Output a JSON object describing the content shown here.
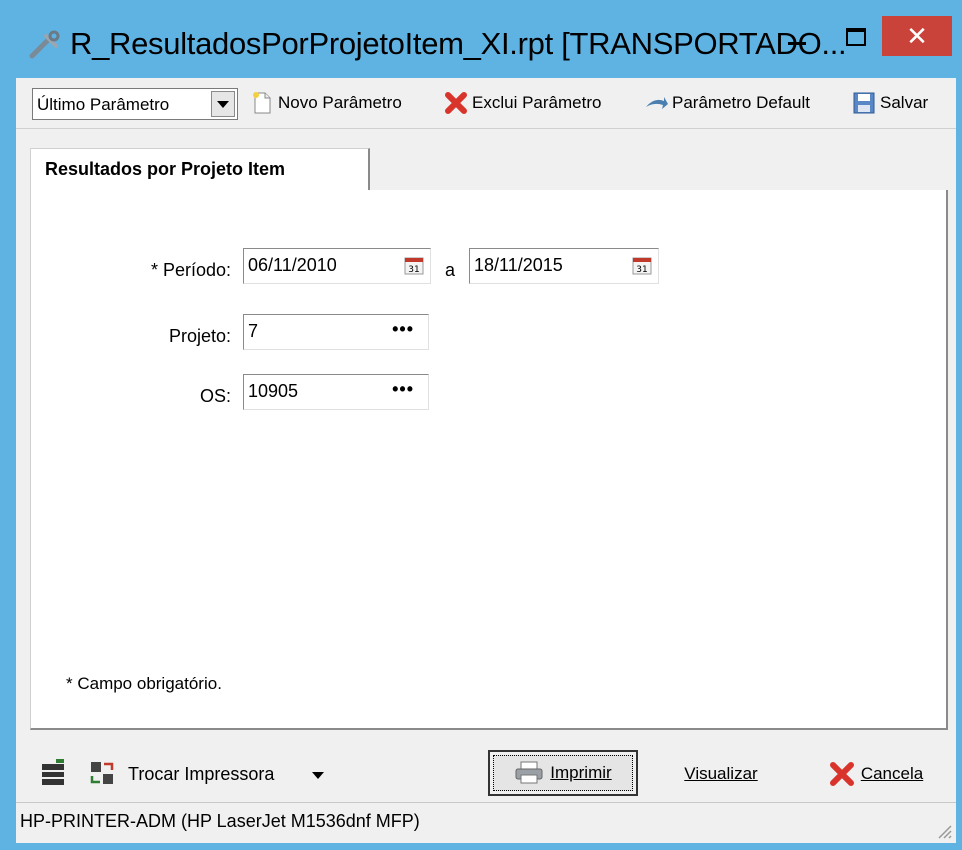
{
  "window": {
    "title": "R_ResultadosPorProjetoItem_XI.rpt [TRANSPORTADO...",
    "close_glyph": "✕",
    "accent_color": "#5fb3e3",
    "close_color": "#c9433a"
  },
  "toolbar": {
    "parameter_select_value": "Último Parâmetro",
    "novo_label": "Novo Parâmetro",
    "exclui_label": "Exclui Parâmetro",
    "default_label": "Parâmetro Default",
    "salvar_label": "Salvar"
  },
  "tab": {
    "label": "Resultados por Projeto Item"
  },
  "form": {
    "periodo_label": "* Período:",
    "periodo_start": "06/11/2010",
    "periodo_separator": "a",
    "periodo_end": "18/11/2015",
    "projeto_label": "Projeto:",
    "projeto_value": "7",
    "os_label": "OS:",
    "os_value": "10905",
    "lookup_glyph": "•••",
    "required_note": "* Campo obrigatório."
  },
  "actions": {
    "trocar_label": "Trocar Impressora",
    "imprimir_label": "Imprimir",
    "visualizar_label": "Visualizar",
    "cancela_label": "Cancela"
  },
  "status": {
    "printer": "HP-PRINTER-ADM (HP LaserJet M1536dnf MFP)"
  },
  "icons": {
    "title": "tools-icon",
    "novo": "new-document-icon",
    "exclui": "red-x-icon",
    "default": "arrow-icon",
    "salvar": "floppy-disk-icon",
    "calendar": "calendar-icon",
    "printer_setup": "printer-settings-icon",
    "swap_printer": "swap-printer-icon",
    "printer": "printer-icon",
    "cancel": "red-x-icon"
  }
}
